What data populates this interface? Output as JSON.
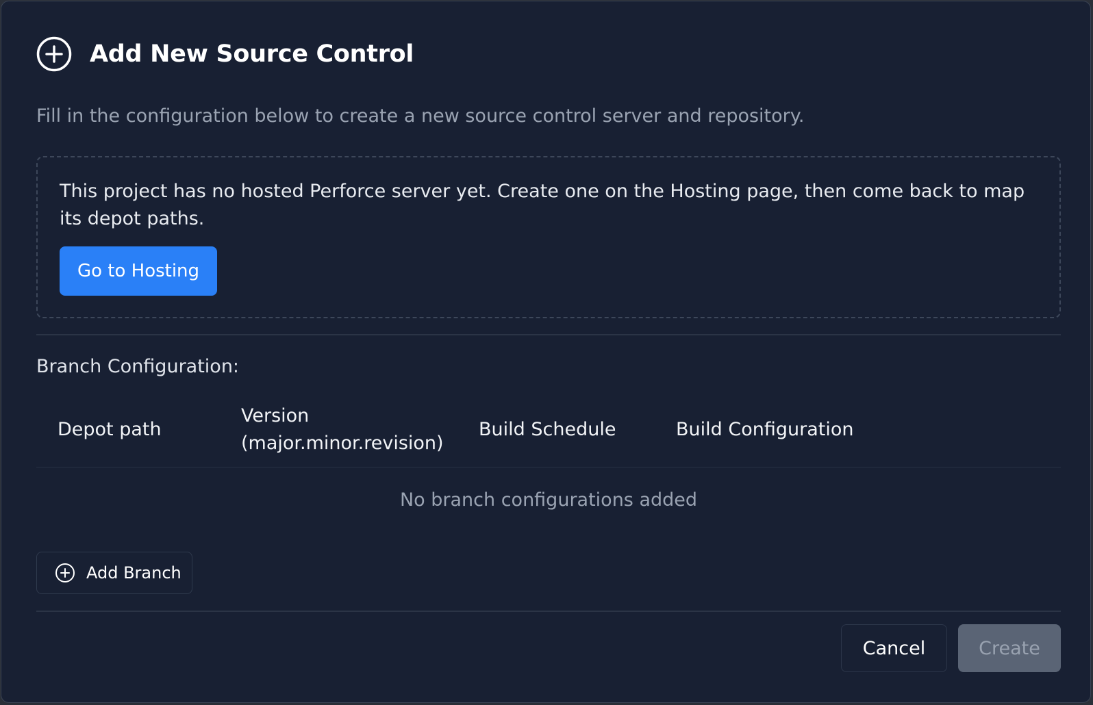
{
  "dialog": {
    "title": "Add New Source Control",
    "subtitle": "Fill in the configuration below to create a new source control server and repository.",
    "header_icon": "plus-circle-icon"
  },
  "notice": {
    "text": "This project has no hosted Perforce server yet. Create one on the Hosting page, then come back to map its depot paths.",
    "button_label": "Go to Hosting"
  },
  "branches": {
    "label": "Branch Configuration:",
    "columns": [
      "Depot path",
      "Version (major.minor.revision)",
      "Build Schedule",
      "Build Configuration"
    ],
    "version_column_line1": "Version",
    "version_column_line2": "(major.minor.revision)",
    "empty_message": "No branch configurations added",
    "add_button_label": "Add Branch",
    "add_button_icon": "plus-circle-icon"
  },
  "footer": {
    "cancel_label": "Cancel",
    "create_label": "Create",
    "create_disabled": true
  },
  "colors": {
    "background": "#182033",
    "primary": "#2a80f7",
    "disabled_button": "#5a6475",
    "muted_text": "#9aa3b2"
  }
}
